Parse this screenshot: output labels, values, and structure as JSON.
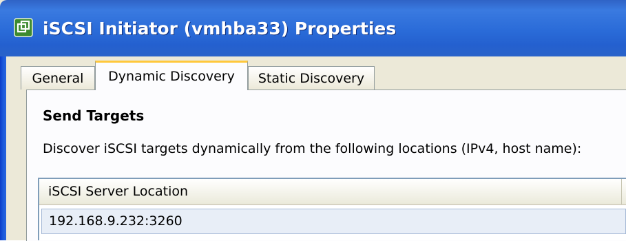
{
  "window": {
    "title": "iSCSI Initiator (vmhba33) Properties",
    "icon": "vsphere-logo-icon"
  },
  "tabs": [
    {
      "label": "General",
      "selected": false
    },
    {
      "label": "Dynamic Discovery",
      "selected": true
    },
    {
      "label": "Static Discovery",
      "selected": false
    }
  ],
  "send_targets": {
    "heading": "Send Targets",
    "description": "Discover iSCSI targets dynamically from the following locations (IPv4, host name):",
    "table": {
      "columns": [
        "iSCSI Server Location"
      ],
      "rows": [
        {
          "location": "192.168.9.232:3260",
          "selected": true
        }
      ]
    }
  },
  "colors": {
    "titlebar": "#2a6bd8",
    "title_text": "#ffffff",
    "tab_highlight": "#ffc83c",
    "dialog_bg": "#ece9d8",
    "selected_row": "#e8eef7"
  }
}
